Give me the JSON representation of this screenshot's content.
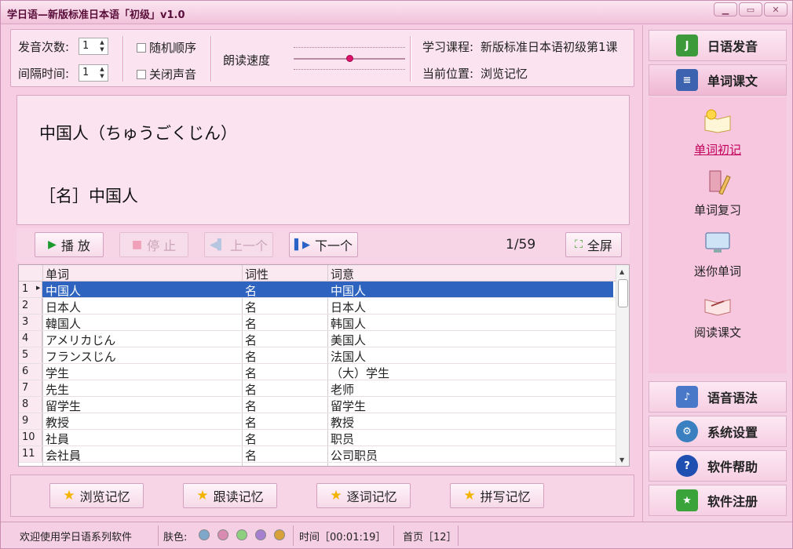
{
  "window": {
    "title": "学日语—新版标准日本语「初级」v1.0",
    "btn_min": "▁",
    "btn_max": "▭",
    "btn_close": "✕"
  },
  "controls": {
    "repeat_label": "发音次数:",
    "repeat_value": "1",
    "interval_label": "间隔时间:",
    "interval_value": "1",
    "random_label": "随机顺序",
    "mute_label": "关闭声音",
    "speed_label": "朗读速度",
    "speed_level": 0.5,
    "course_label": "学习课程:",
    "course_value": "新版标准日本语初级第1课",
    "position_label": "当前位置:",
    "position_value": "浏览记忆"
  },
  "display": {
    "line1": "中国人（ちゅうごくじん）",
    "line2": "［名］中国人"
  },
  "playback": {
    "play": "播 放",
    "stop": "停 止",
    "prev": "上一个",
    "next": "下一个",
    "counter": "1/59",
    "fullscreen": "全屏"
  },
  "table": {
    "headers": [
      "单词",
      "词性",
      "词意"
    ],
    "rows": [
      {
        "n": "1",
        "word": "中国人",
        "pos": "名",
        "meaning": "中国人"
      },
      {
        "n": "2",
        "word": "日本人",
        "pos": "名",
        "meaning": "日本人"
      },
      {
        "n": "3",
        "word": "韓国人",
        "pos": "名",
        "meaning": "韩国人"
      },
      {
        "n": "4",
        "word": "アメリカじん",
        "pos": "名",
        "meaning": "美国人"
      },
      {
        "n": "5",
        "word": "フランスじん",
        "pos": "名",
        "meaning": "法国人"
      },
      {
        "n": "6",
        "word": "学生",
        "pos": "名",
        "meaning": "（大）学生"
      },
      {
        "n": "7",
        "word": "先生",
        "pos": "名",
        "meaning": "老师"
      },
      {
        "n": "8",
        "word": "留学生",
        "pos": "名",
        "meaning": "留学生"
      },
      {
        "n": "9",
        "word": "教授",
        "pos": "名",
        "meaning": "教授"
      },
      {
        "n": "10",
        "word": "社員",
        "pos": "名",
        "meaning": "职员"
      },
      {
        "n": "11",
        "word": "会社員",
        "pos": "名",
        "meaning": "公司职员"
      }
    ]
  },
  "memory": {
    "browse": "浏览记忆",
    "follow": "跟读记忆",
    "word": "逐词记忆",
    "spell": "拼写记忆"
  },
  "status": {
    "welcome": "欢迎使用学日语系列软件",
    "skin_label": "肤色:",
    "skins": [
      "#7fa7c9",
      "#d98bb3",
      "#8fd07e",
      "#a77fd1",
      "#d9a13a"
    ],
    "time": "时间［00:01:19］",
    "page": "首页［12］"
  },
  "nav": {
    "pronunciation": "日语发音",
    "vocab_text": "单词课文",
    "sub_first": "单词初记",
    "sub_review": "单词复习",
    "sub_mini": "迷你单词",
    "sub_read": "阅读课文",
    "grammar": "语音语法",
    "settings": "系统设置",
    "help": "软件帮助",
    "register": "软件注册"
  }
}
